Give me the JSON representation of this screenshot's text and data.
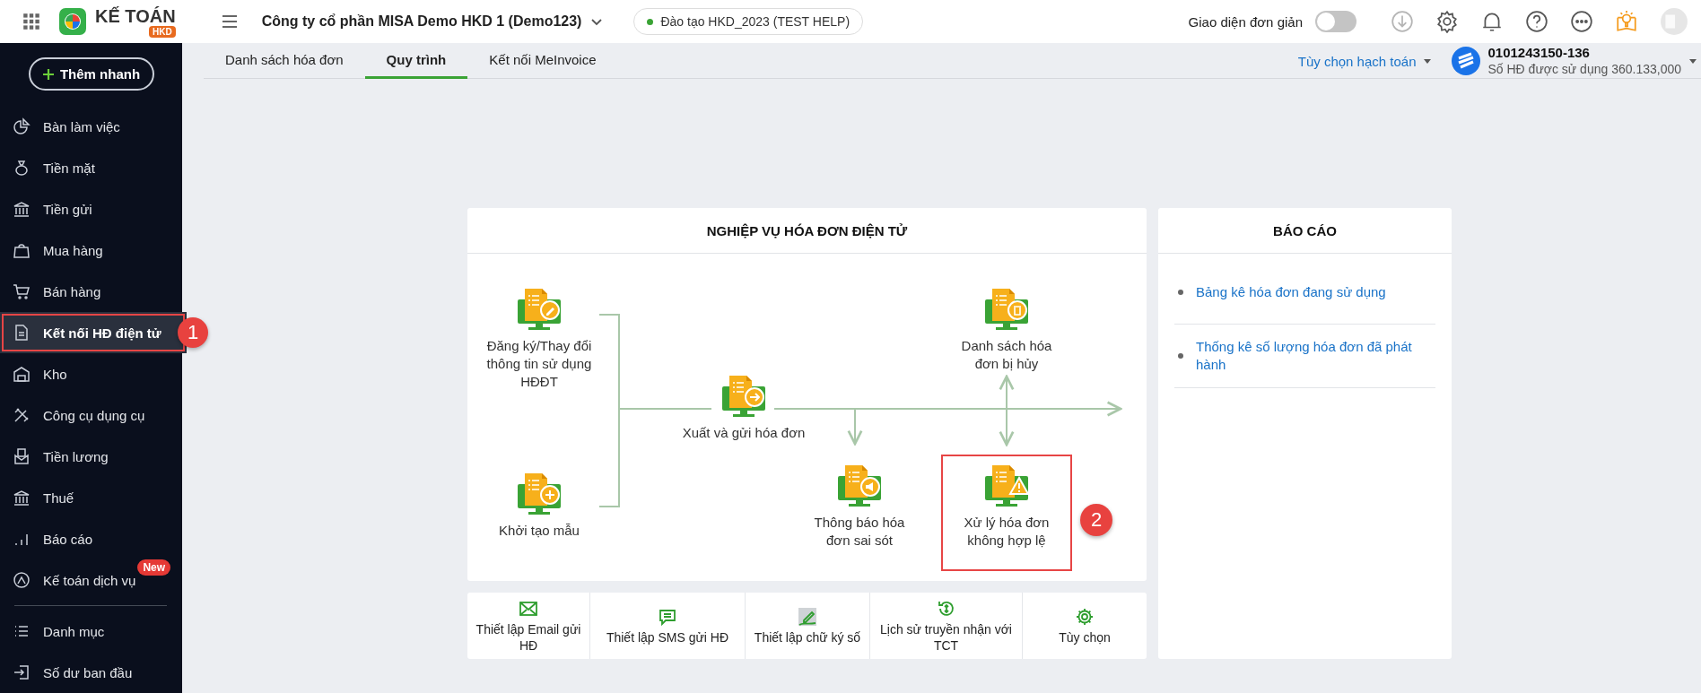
{
  "top_bar": {
    "logo_text": "KẾ TOÁN",
    "logo_badge": "HKD",
    "company": "Công ty cổ phần MISA Demo HKD 1 (Demo123)",
    "environment": "Đào tạo HKD_2023 (TEST HELP)",
    "simple_mode": {
      "label": "Giao diện đơn giản",
      "on": false
    }
  },
  "sidebar": {
    "quick_add": "Thêm nhanh",
    "items": [
      {
        "label": "Bàn làm việc",
        "selected": false,
        "highlighted": false
      },
      {
        "label": "Tiền mặt",
        "selected": false,
        "highlighted": false
      },
      {
        "label": "Tiền gửi",
        "selected": false,
        "highlighted": false
      },
      {
        "label": "Mua hàng",
        "selected": false,
        "highlighted": false
      },
      {
        "label": "Bán hàng",
        "selected": false,
        "highlighted": false
      },
      {
        "label": "Kết nối HĐ điện tử",
        "selected": true,
        "highlighted": true,
        "step": "1"
      },
      {
        "label": "Kho",
        "selected": false,
        "highlighted": false
      },
      {
        "label": "Công cụ dụng cụ",
        "selected": false,
        "highlighted": false
      },
      {
        "label": "Tiền lương",
        "selected": false,
        "highlighted": false
      },
      {
        "label": "Thuế",
        "selected": false,
        "highlighted": false
      },
      {
        "label": "Báo cáo",
        "selected": false,
        "highlighted": false
      },
      {
        "label": "Kế toán dịch vụ",
        "selected": false,
        "highlighted": false,
        "badge": "New"
      }
    ],
    "bottom_items": [
      {
        "label": "Danh mục",
        "selected": false,
        "highlighted": false
      },
      {
        "label": "Số dư ban đầu",
        "selected": false,
        "highlighted": false
      }
    ]
  },
  "tabs": [
    {
      "label": "Danh sách hóa đơn",
      "selected": false
    },
    {
      "label": "Quy trình",
      "selected": true
    },
    {
      "label": "Kết nối MeInvoice",
      "selected": false
    }
  ],
  "account": {
    "options_link": "Tùy chọn hạch toán",
    "tax_code": "0101243150-136",
    "usage": "Số HĐ được sử dụng 360.133,000"
  },
  "workflow": {
    "title": "NGHIỆP VỤ HÓA ĐƠN ĐIỆN TỬ",
    "nodes": [
      {
        "label": "Đăng ký/Thay đổi thông tin sử dụng HĐĐT",
        "highlighted": false
      },
      {
        "label": "Khởi tạo mẫu",
        "highlighted": false
      },
      {
        "label": "Xuất và gửi hóa đơn",
        "highlighted": false
      },
      {
        "label": "Danh sách hóa đơn bị hủy",
        "highlighted": false
      },
      {
        "label": "Thông báo hóa đơn sai sót",
        "highlighted": false
      },
      {
        "label": "Xử lý hóa đơn không hợp lệ",
        "highlighted": true,
        "step": "2"
      }
    ]
  },
  "tools": [
    "Thiết lập Email gửi HĐ",
    "Thiết lập SMS gửi HĐ",
    "Thiết lập chữ ký số",
    "Lịch sử truyền nhận với TCT",
    "Tùy chọn"
  ],
  "report": {
    "title": "BÁO CÁO",
    "links": [
      "Bảng kê hóa đơn đang sử dụng",
      "Thống kê số lượng hóa đơn đã phát hành"
    ]
  }
}
